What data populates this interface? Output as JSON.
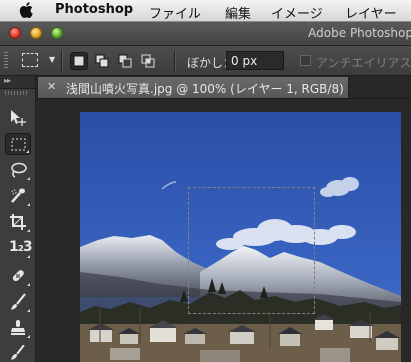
{
  "menubar": {
    "app_name": "Photoshop",
    "items": [
      "ファイル",
      "編集",
      "イメージ",
      "レイヤー"
    ]
  },
  "window": {
    "app_title": "Adobe Photoshop"
  },
  "options": {
    "feather_label": "ぼかし：",
    "feather_value": "0 px",
    "antialias_label": "アンチエイリアス",
    "antialias_checked": false
  },
  "document": {
    "tab_title": "浅間山噴火写真.jpg @ 100% (レイヤー 1, RGB/8) *"
  },
  "toolbox": {
    "tools": [
      {
        "name": "move-tool-icon"
      },
      {
        "name": "rectangular-marquee-tool-icon",
        "active": true
      },
      {
        "name": "lasso-tool-icon"
      },
      {
        "name": "quick-selection-tool-icon"
      },
      {
        "name": "crop-tool-icon"
      },
      {
        "name": "count-tool-icon",
        "text": "1₂3"
      },
      {
        "name": "healing-brush-tool-icon"
      },
      {
        "name": "brush-tool-icon"
      },
      {
        "name": "clone-stamp-tool-icon"
      }
    ]
  },
  "colors": {
    "menubar": "#e6e6e6",
    "panel": "#3d3d3d",
    "canvas_bg": "#282828",
    "sky": "#2f56b0"
  }
}
